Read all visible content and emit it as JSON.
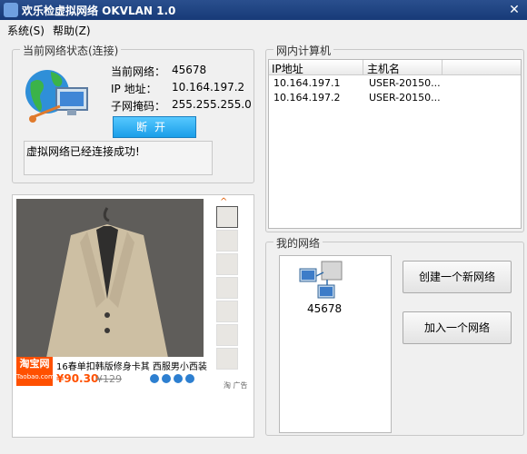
{
  "window": {
    "title": "欢乐检虚拟网络 OKVLAN 1.0",
    "close_label": "✕"
  },
  "menu": [
    {
      "label": "系统(S)"
    },
    {
      "label": "帮助(Z)"
    }
  ],
  "status_group": {
    "title": "当前网络状态(连接)",
    "network_label": "当前网络：",
    "network_value": "45678",
    "ip_label": "IP  地址：",
    "ip_value": "10.164.197.2",
    "mask_label": "子网掩码：",
    "mask_value": "255.255.255.0",
    "disconnect_label": "断开",
    "message": "虚拟网络已经连接成功!"
  },
  "lan_group": {
    "title": "网内计算机",
    "columns": [
      "IP地址",
      "主机名"
    ],
    "rows": [
      {
        "ip": "10.164.197.1",
        "host": "USER-20150..."
      },
      {
        "ip": "10.164.197.2",
        "host": "USER-20150..."
      }
    ]
  },
  "my_network_group": {
    "title": "我的网络",
    "network_name": "45678",
    "create_label": "创建一个新网络",
    "join_label": "加入一个网络"
  },
  "ad": {
    "brand": "淘宝网",
    "brand_sub": "Taobao.com",
    "product_title": "16春单扣韩版修身卡其 西服男小西装",
    "price": "¥90.30",
    "old_price": "¥129",
    "ad_mark": "淘  广告"
  }
}
